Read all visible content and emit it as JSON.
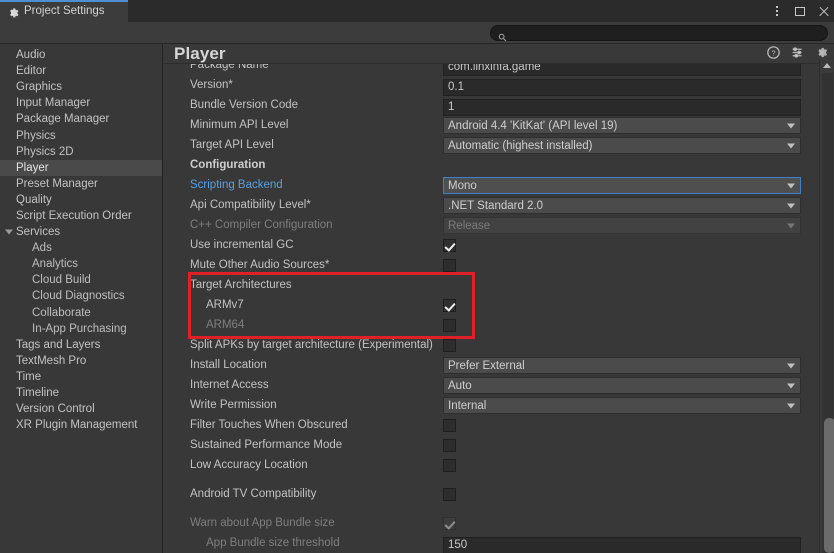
{
  "window": {
    "tab_label": "Project Settings",
    "tab_icon": "gear-icon",
    "controls": {
      "menu": "kebab-menu-icon",
      "maximize": "maximize-icon",
      "close": "close-icon"
    }
  },
  "toolbar": {
    "search_icon": "search-icon",
    "search_value": "",
    "search_placeholder": ""
  },
  "sidebar": {
    "items": [
      {
        "label": "Audio",
        "level": 0,
        "selected": false
      },
      {
        "label": "Editor",
        "level": 0,
        "selected": false
      },
      {
        "label": "Graphics",
        "level": 0,
        "selected": false
      },
      {
        "label": "Input Manager",
        "level": 0,
        "selected": false
      },
      {
        "label": "Package Manager",
        "level": 0,
        "selected": false
      },
      {
        "label": "Physics",
        "level": 0,
        "selected": false
      },
      {
        "label": "Physics 2D",
        "level": 0,
        "selected": false
      },
      {
        "label": "Player",
        "level": 0,
        "selected": true
      },
      {
        "label": "Preset Manager",
        "level": 0,
        "selected": false
      },
      {
        "label": "Quality",
        "level": 0,
        "selected": false
      },
      {
        "label": "Script Execution Order",
        "level": 0,
        "selected": false
      },
      {
        "label": "Services",
        "level": 0,
        "selected": false,
        "expander": "expanded"
      },
      {
        "label": "Ads",
        "level": 1,
        "selected": false
      },
      {
        "label": "Analytics",
        "level": 1,
        "selected": false
      },
      {
        "label": "Cloud Build",
        "level": 1,
        "selected": false
      },
      {
        "label": "Cloud Diagnostics",
        "level": 1,
        "selected": false
      },
      {
        "label": "Collaborate",
        "level": 1,
        "selected": false
      },
      {
        "label": "In-App Purchasing",
        "level": 1,
        "selected": false
      },
      {
        "label": "Tags and Layers",
        "level": 0,
        "selected": false
      },
      {
        "label": "TextMesh Pro",
        "level": 0,
        "selected": false
      },
      {
        "label": "Time",
        "level": 0,
        "selected": false
      },
      {
        "label": "Timeline",
        "level": 0,
        "selected": false
      },
      {
        "label": "Version Control",
        "level": 0,
        "selected": false
      },
      {
        "label": "XR Plugin Management",
        "level": 0,
        "selected": false
      }
    ]
  },
  "panel": {
    "title": "Player",
    "icons": [
      {
        "name": "help-icon"
      },
      {
        "name": "preset-icon"
      },
      {
        "name": "gear-icon"
      }
    ]
  },
  "settings": {
    "rows": [
      {
        "label": "Package Name",
        "type": "text",
        "value": "com.linxinfa.game"
      },
      {
        "label": "Version*",
        "type": "text",
        "value": "0.1"
      },
      {
        "label": "Bundle Version Code",
        "type": "text",
        "value": "1"
      },
      {
        "label": "Minimum API Level",
        "type": "dropdown",
        "value": "Android 4.4 'KitKat' (API level 19)"
      },
      {
        "label": "Target API Level",
        "type": "dropdown",
        "value": "Automatic (highest installed)"
      },
      {
        "label": "Configuration",
        "type": "section"
      },
      {
        "label": "Scripting Backend",
        "type": "dropdown",
        "value": "Mono",
        "label_style": "link",
        "focused": true
      },
      {
        "label": "Api Compatibility Level*",
        "type": "dropdown",
        "value": ".NET Standard 2.0"
      },
      {
        "label": "C++ Compiler Configuration",
        "type": "dropdown",
        "value": "Release",
        "disabled": true,
        "label_style": "dim"
      },
      {
        "label": "Use incremental GC",
        "type": "checkbox",
        "checked": true
      },
      {
        "label": "Mute Other Audio Sources*",
        "type": "checkbox",
        "checked": false
      },
      {
        "label": "Target Architectures",
        "type": "group"
      },
      {
        "label": "ARMv7",
        "type": "checkbox",
        "checked": true,
        "indent": true
      },
      {
        "label": "ARM64",
        "type": "checkbox",
        "checked": false,
        "indent": true,
        "label_style": "dim"
      },
      {
        "label": "Split APKs by target architecture (Experimental)",
        "type": "checkbox",
        "checked": false
      },
      {
        "label": "Install Location",
        "type": "dropdown",
        "value": "Prefer External"
      },
      {
        "label": "Internet Access",
        "type": "dropdown",
        "value": "Auto"
      },
      {
        "label": "Write Permission",
        "type": "dropdown",
        "value": "Internal"
      },
      {
        "label": "Filter Touches When Obscured",
        "type": "checkbox",
        "checked": false
      },
      {
        "label": "Sustained Performance Mode",
        "type": "checkbox",
        "checked": false
      },
      {
        "label": "Low Accuracy Location",
        "type": "checkbox",
        "checked": false
      },
      {
        "label": "",
        "type": "spacer"
      },
      {
        "label": "Android TV Compatibility",
        "type": "checkbox",
        "checked": false
      },
      {
        "label": "",
        "type": "spacer"
      },
      {
        "label": "Warn about App Bundle size",
        "type": "checkbox",
        "checked": true,
        "label_style": "dim",
        "dim_box": true
      },
      {
        "label": "App Bundle size threshold",
        "type": "text",
        "value": "150",
        "indent": true,
        "label_style": "dim"
      }
    ]
  },
  "annotation": {
    "highlight_color": "#e01f26",
    "highlight_target": "Target Architectures"
  },
  "scrollbar": {
    "up_arrow": "scroll-up-arrow-icon"
  }
}
